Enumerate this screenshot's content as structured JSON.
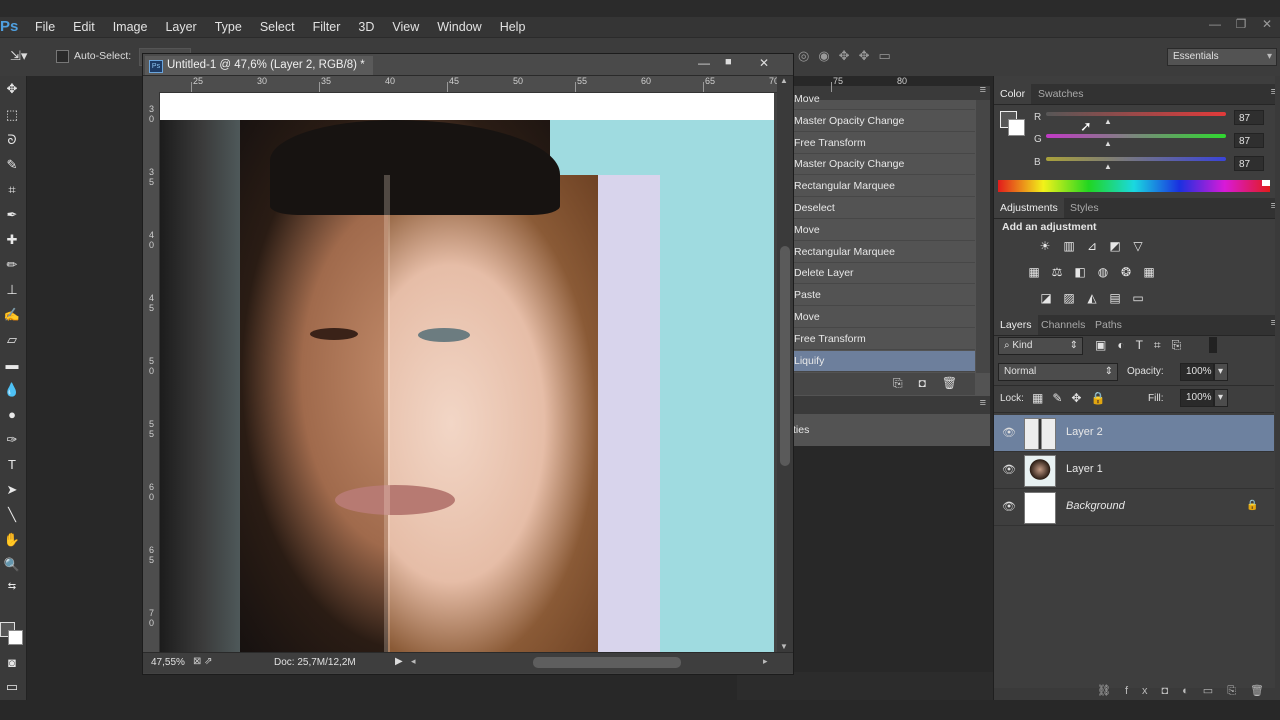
{
  "app": {
    "logo": "Ps",
    "window_controls": [
      "—",
      "❐",
      "✕"
    ]
  },
  "menu": [
    "File",
    "Edit",
    "Image",
    "Layer",
    "Type",
    "Select",
    "Filter",
    "3D",
    "View",
    "Window",
    "Help"
  ],
  "options": {
    "auto_select": "Auto-Select:",
    "workspace": "Essentials"
  },
  "document": {
    "tab_title": "Untitled-1 @ 47,6% (Layer 2, RGB/8) *",
    "ruler_top": [
      "25",
      "30",
      "35",
      "40",
      "45",
      "50",
      "55",
      "60",
      "65",
      "70",
      "75",
      "80"
    ],
    "ruler_left": [
      "3\n0",
      "3\n5",
      "4\n0",
      "4\n5",
      "5\n0",
      "5\n5",
      "6\n0",
      "6\n5",
      "7\n0"
    ],
    "zoom": "47,55%",
    "doc_size": "Doc: 25,7M/12,2M"
  },
  "history": {
    "items": [
      "Move",
      "Master Opacity Change",
      "Free Transform",
      "Master Opacity Change",
      "Rectangular Marquee",
      "Deselect",
      "Move",
      "Rectangular Marquee",
      "Delete Layer",
      "Paste",
      "Move",
      "Free Transform",
      "Liquify"
    ],
    "selected_index": 12,
    "properties_label": "ties"
  },
  "color_panel": {
    "tabs": [
      "Color",
      "Swatches"
    ],
    "channels": [
      {
        "label": "R",
        "value": "87"
      },
      {
        "label": "G",
        "value": "87"
      },
      {
        "label": "B",
        "value": "87"
      }
    ]
  },
  "adjustments": {
    "tabs": [
      "Adjustments",
      "Styles"
    ],
    "add_label": "Add an adjustment"
  },
  "layers_panel": {
    "tabs": [
      "Layers",
      "Channels",
      "Paths"
    ],
    "filter_kind": "Kind",
    "blend_mode": "Normal",
    "opacity_label": "Opacity:",
    "opacity_value": "100%",
    "lock_label": "Lock:",
    "fill_label": "Fill:",
    "fill_value": "100%",
    "layers": [
      {
        "name": "Layer 2",
        "selected": true
      },
      {
        "name": "Layer 1",
        "selected": false
      },
      {
        "name": "Background",
        "selected": false,
        "locked": true
      }
    ]
  },
  "colors": {
    "selection": "#6d819f",
    "canvas_bg": "#9fdbe0"
  }
}
